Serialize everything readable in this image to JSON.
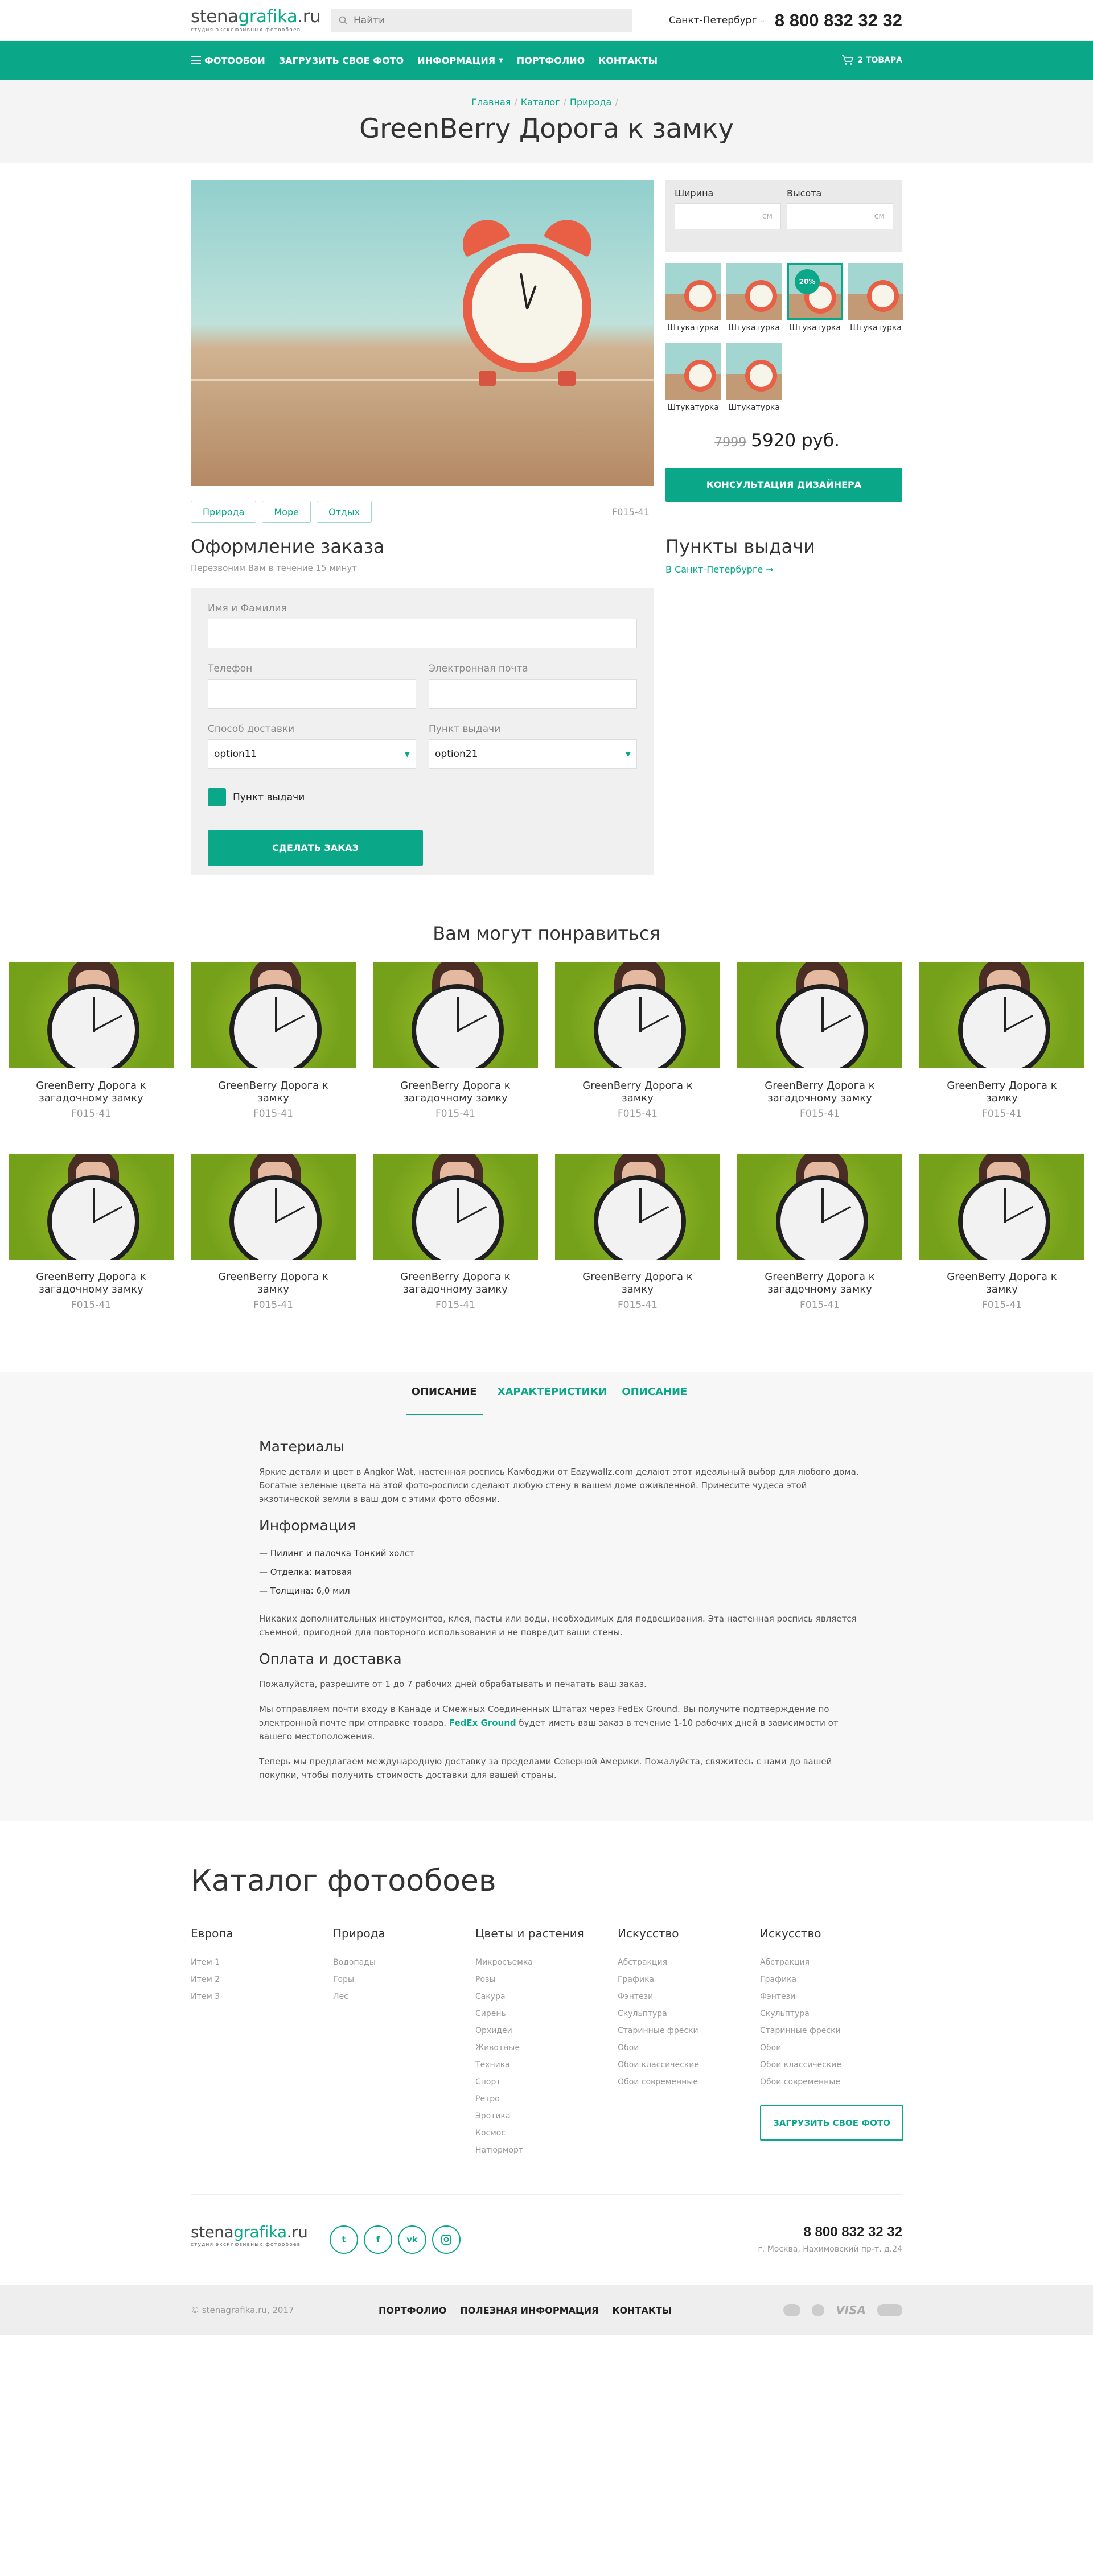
{
  "logo": {
    "main_a": "stena",
    "main_b": "grafika",
    "main_c": ".ru",
    "tagline": "студия эксклюзивных фотообоев"
  },
  "header": {
    "search_placeholder": "Найти",
    "city": "Санкт-Петербург",
    "phone": "8 800 832 32 32"
  },
  "nav": {
    "items": [
      "ФОТООБОИ",
      "ЗАГРУЗИТЬ СВОЕ ФОТО",
      "ИНФОРМАЦИЯ",
      "ПОРТФОЛИО",
      "КОНТАКТЫ"
    ],
    "cart": "2 ТОВАРА"
  },
  "breadcrumb": [
    "Главная",
    "Каталог",
    "Природа"
  ],
  "page_title": "GreenBerry Дорога к замку",
  "product": {
    "tags": [
      "Природа",
      "Море",
      "Отдых"
    ],
    "sku": "F015-41",
    "width_label": "Ширина",
    "height_label": "Высота",
    "unit": "см",
    "swatches": [
      "Штукатурка",
      "Штукатурка",
      "Штукатурка",
      "Штукатурка",
      "Штукатурка",
      "Штукатурка"
    ],
    "swatch_badge": "20%",
    "old_price": "7999",
    "price": "5920 руб.",
    "consult_button": "КОНСУЛЬТАЦИЯ ДИЗАЙНЕРА"
  },
  "order": {
    "title": "Оформление заказа",
    "subtitle": "Перезвоним Вам в течение 15 минут",
    "name_label": "Имя и Фамилия",
    "phone_label": "Телефон",
    "email_label": "Электронная почта",
    "delivery_label": "Способ доставки",
    "delivery_value": "option11",
    "pickup_label": "Пункт выдачи",
    "pickup_value": "option21",
    "checkbox_label": "Пункт выдачи",
    "submit": "СДЕЛАТЬ ЗАКАЗ"
  },
  "pickup": {
    "title": "Пункты выдачи",
    "link": "В Санкт-Петербурге →"
  },
  "recs": {
    "title": "Вам могут понравиться",
    "items": [
      {
        "title": "GreenBerry Дорога к загадочному замку",
        "sku": "F015-41"
      },
      {
        "title": "GreenBerry Дорога к замку",
        "sku": "F015-41"
      },
      {
        "title": "GreenBerry Дорога к загадочному замку",
        "sku": "F015-41"
      },
      {
        "title": "GreenBerry Дорога к замку",
        "sku": "F015-41"
      },
      {
        "title": "GreenBerry Дорога к загадочному замку",
        "sku": "F015-41"
      },
      {
        "title": "GreenBerry Дорога к замку",
        "sku": "F015-41"
      },
      {
        "title": "GreenBerry Дорога к загадочному замку",
        "sku": "F015-41"
      },
      {
        "title": "GreenBerry Дорога к замку",
        "sku": "F015-41"
      },
      {
        "title": "GreenBerry Дорога к загадочному замку",
        "sku": "F015-41"
      },
      {
        "title": "GreenBerry Дорога к замку",
        "sku": "F015-41"
      },
      {
        "title": "GreenBerry Дорога к загадочному замку",
        "sku": "F015-41"
      },
      {
        "title": "GreenBerry Дорога к замку",
        "sku": "F015-41"
      }
    ]
  },
  "tabs": [
    "ОПИСАНИЕ",
    "ХАРАКТЕРИСТИКИ",
    "ОПИСАНИЕ"
  ],
  "description": {
    "materials_title": "Материалы",
    "materials_text": "Яркие детали и цвет в Angkor Wat, настенная роспись Камбоджи от Eazywallz.com делают этот идеальный выбор для любого дома. Богатые зеленые цвета на этой фото-росписи сделают любую стену в вашем доме оживленной. Принесите чудеса этой экзотической земли в ваш дом с этими фото обоями.",
    "info_title": "Информация",
    "info_list": [
      "Пилинг и палочка Тонкий холст",
      "Отделка: матовая",
      "Толщина: 6,0 мил"
    ],
    "info_text": "Никаких дополнительных инструментов, клея, пасты или воды, необходимых для подвешивания. Эта настенная роспись является съемной, пригодной для повторного использования и не повредит ваши стены.",
    "pay_title": "Оплата и доставка",
    "pay_text1": "Пожалуйста, разрешите от 1 до 7 рабочих дней обрабатывать и печатать ваш заказ.",
    "pay_text2a": "Мы отправляем почти входу в Канаде и Смежных Соединенных Штатах через FedEx Ground. Вы получите подтверждение по электронной почте при отправке товара. ",
    "pay_text2b": "FedEx Ground",
    "pay_text2c": " будет иметь ваш заказ в течение 1-10 рабочих дней в зависимости от вашего местоположения.",
    "pay_text3": "Теперь мы предлагаем международную доставку за пределами Северной Америки. Пожалуйста, свяжитесь с нами до вашей покупки, чтобы получить стоимость доставки для вашей страны."
  },
  "catalog": {
    "title": "Каталог фотообоев",
    "columns": [
      {
        "head": "Европа",
        "items": [
          "Итем 1",
          "Итем 2",
          "Итем 3"
        ]
      },
      {
        "head": "Природа",
        "items": [
          "Водопады",
          "Горы",
          "Лес"
        ]
      },
      {
        "head": "Цветы и растения",
        "items": [
          "Микросъемка",
          "Розы",
          "Сакура",
          "Сирень",
          "Орхидеи",
          "Животные",
          "Техника",
          "Спорт",
          "Ретро",
          "Эротика",
          "Космос",
          "Натюрморт"
        ]
      },
      {
        "head": "Искусство",
        "items": [
          "Абстракция",
          "Графика",
          "Фэнтези",
          "Скульптура",
          "Старинные фрески",
          "Обои",
          "Обои классические",
          "Обои современные"
        ]
      },
      {
        "head": "Искусство",
        "items": [
          "Абстракция",
          "Графика",
          "Фэнтези",
          "Скульптура",
          "Старинные фрески",
          "Обои",
          "Обои классические",
          "Обои современные"
        ]
      }
    ],
    "upload_button": "ЗАГРУЗИТЬ СВОЕ ФОТО"
  },
  "footer": {
    "phone": "8 800 832 32 32",
    "address": "г. Москва, Нахимовский пр-т, д.24",
    "socials": [
      "twitter-icon",
      "facebook-icon",
      "vk-icon",
      "instagram-icon"
    ],
    "copyright": "© stenagrafika.ru, 2017",
    "links": [
      "ПОРТФОЛИО",
      "ПОЛЕЗНАЯ ИНФОРМАЦИЯ",
      "КОНТАКТЫ"
    ],
    "payments": [
      "mastercard-icon",
      "visa-icon",
      "maestro-icon"
    ],
    "visa_text": "VISA"
  },
  "colors": {
    "accent": "#0aa889",
    "hero_bg": "#f4f4f4",
    "form_bg": "#f0f0f0"
  }
}
